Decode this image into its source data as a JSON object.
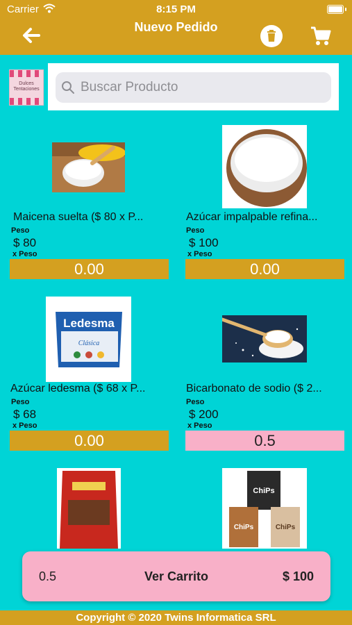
{
  "status_bar": {
    "carrier": "Carrier",
    "time": "8:15 PM"
  },
  "nav": {
    "title": "Nuevo Pedido",
    "back_icon": "arrow-left-icon",
    "trash_icon": "trash-icon",
    "cart_icon": "cart-icon"
  },
  "logo": {
    "text": "Dulces Tentaciones"
  },
  "search": {
    "placeholder": "Buscar Producto",
    "value": ""
  },
  "products": [
    {
      "name": "Maicena suelta ($ 80 x P...",
      "unit_label": "Peso",
      "price": "$ 80",
      "per": "x Peso",
      "quantity": "0.00"
    },
    {
      "name": "Azúcar impalpable refina...",
      "unit_label": "Peso",
      "price": "$ 100",
      "per": "x Peso",
      "quantity": "0.00"
    },
    {
      "name": "Azúcar ledesma ($ 68 x P...",
      "unit_label": "Peso",
      "price": "$ 68",
      "per": "x Peso",
      "quantity": "0.00"
    },
    {
      "name": "Bicarbonato de sodio ($ 2...",
      "unit_label": "Peso",
      "price": "$ 200",
      "per": "x Peso",
      "quantity": "0.5"
    },
    {
      "name": "",
      "unit_label": "",
      "price": "",
      "per": "",
      "quantity": ""
    },
    {
      "name": "",
      "unit_label": "",
      "price": "",
      "per": "",
      "quantity": ""
    }
  ],
  "product_images": {
    "p3_brand": "Ledesma",
    "p3_sub": "Clásica",
    "p6_label": "ChiPs"
  },
  "cart": {
    "quantity": "0.5",
    "label": "Ver Carrito",
    "total": "$ 100"
  },
  "footer": {
    "text": "Copyright © 2020 Twins Informatica SRL"
  },
  "colors": {
    "background": "#00d4d6",
    "header": "#d4a020",
    "qty_zero": "#d4a020",
    "qty_set": "#f8b0c8"
  }
}
